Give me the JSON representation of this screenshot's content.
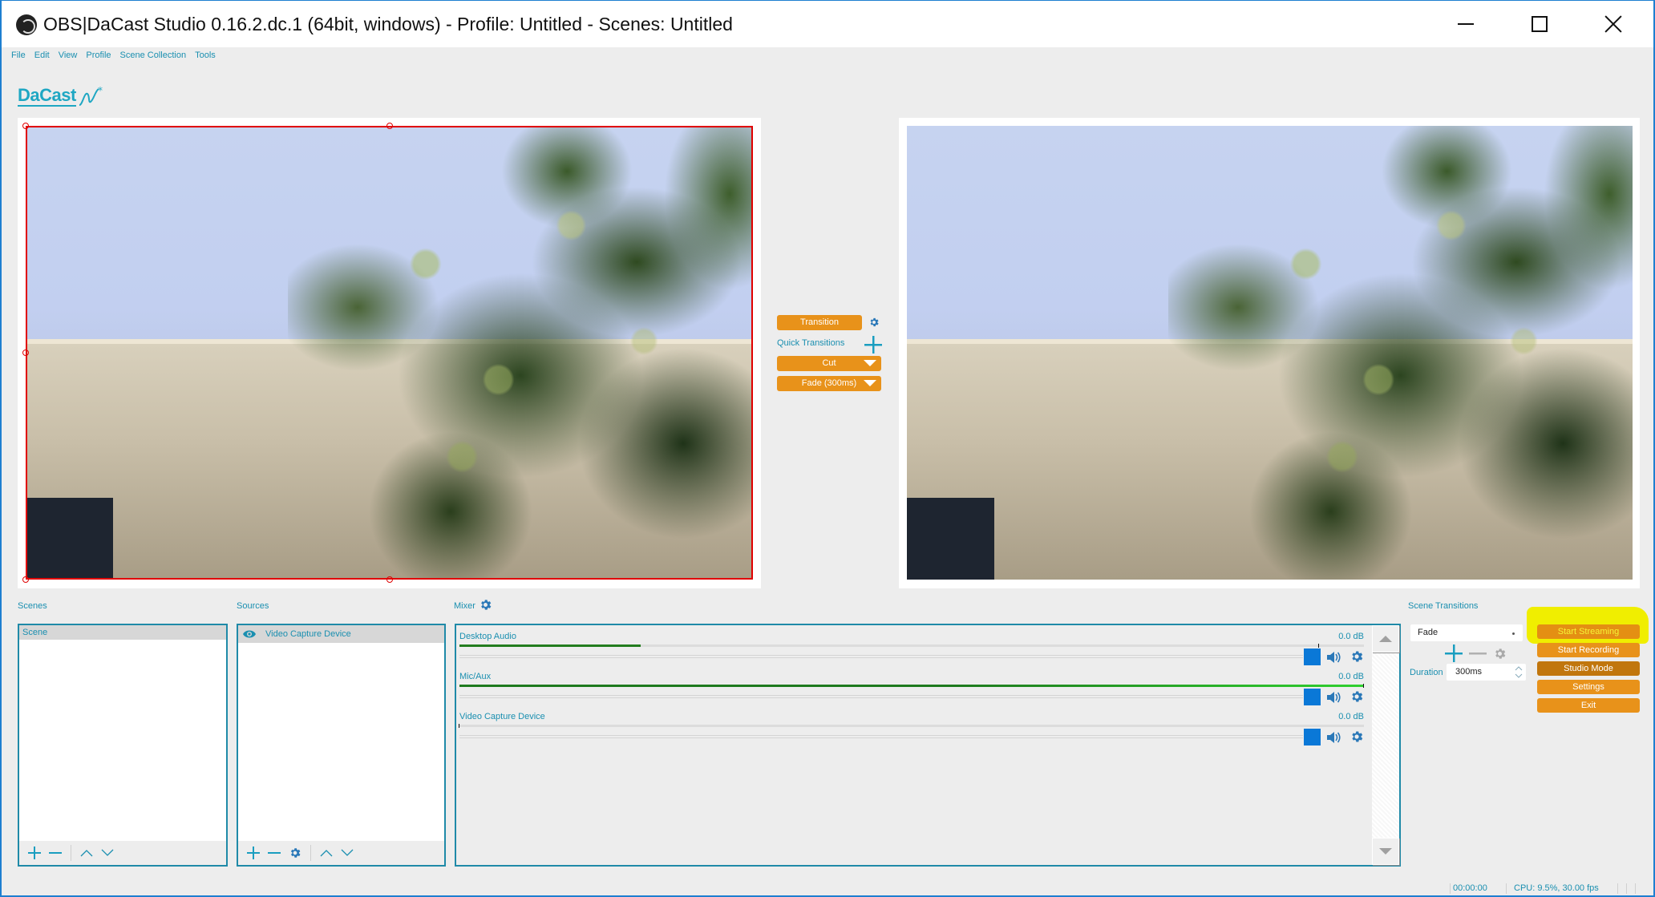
{
  "window": {
    "title": "OBS|DaCast Studio 0.16.2.dc.1 (64bit, windows) - Profile: Untitled - Scenes: Untitled",
    "controls": [
      "minimize",
      "maximize",
      "close"
    ]
  },
  "menu": [
    "File",
    "Edit",
    "View",
    "Profile",
    "Scene Collection",
    "Tools"
  ],
  "logo": {
    "text": "DaCast"
  },
  "colors": {
    "accent_orange": "#e8921a",
    "studio_mode_orange": "#c1760d",
    "teal_text": "#1a8fb0",
    "panel_border": "#1f8aa8",
    "window_border": "#1e7fd0",
    "selection_red": "#e00000",
    "slider_blue": "#0a78d7",
    "highlight_yellow": "#f0ee00"
  },
  "transitions": {
    "transition_button": "Transition",
    "quick_transitions_label": "Quick Transitions",
    "quick": [
      {
        "label": "Cut"
      },
      {
        "label": "Fade (300ms)"
      }
    ]
  },
  "scenes": {
    "label": "Scenes",
    "items": [
      {
        "name": "Scene",
        "selected": true
      }
    ]
  },
  "sources": {
    "label": "Sources",
    "items": [
      {
        "name": "Video Capture Device",
        "visible": true,
        "selected": true
      }
    ]
  },
  "mixer": {
    "label": "Mixer",
    "channels": [
      {
        "name": "Desktop Audio",
        "db": "0.0 dB",
        "level": 0.2,
        "peak": 0.95,
        "volume": 1.0
      },
      {
        "name": "Mic/Aux",
        "db": "0.0 dB",
        "level": 1.0,
        "peak": 1.0,
        "volume": 1.0
      },
      {
        "name": "Video Capture Device",
        "db": "0.0 dB",
        "level": 0.0,
        "peak": 0.0,
        "volume": 1.0
      }
    ]
  },
  "scene_transitions": {
    "label": "Scene Transitions",
    "selected": "Fade",
    "duration_label": "Duration",
    "duration_value": "300ms"
  },
  "controls": {
    "start_streaming": "Start Streaming",
    "start_recording": "Start Recording",
    "studio_mode": "Studio Mode",
    "settings": "Settings",
    "exit": "Exit"
  },
  "status": {
    "time": "00:00:00",
    "cpu": "CPU: 9.5%, 30.00 fps"
  }
}
